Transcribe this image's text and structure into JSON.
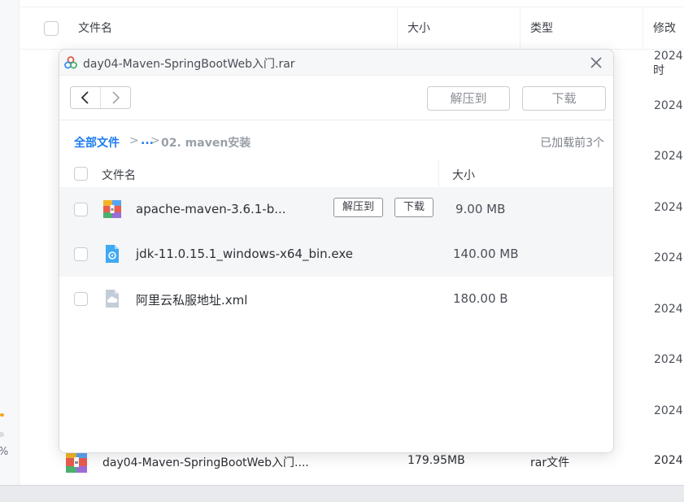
{
  "background": {
    "percent_text": "%",
    "columns": {
      "name": "文件名",
      "size": "大小",
      "type": "类型",
      "modified": "修改时"
    },
    "dates": [
      "2024.",
      "2024.",
      "2024.",
      "2024.",
      "2024.",
      "2024.",
      "2024.",
      "2024.",
      "2024."
    ],
    "bottom_row": {
      "name": "day04-Maven-SpringBootWeb入门....",
      "size": "179.95MB",
      "type": "rar文件",
      "modified": "2024."
    }
  },
  "dialog": {
    "title": "day04-Maven-SpringBootWeb入门.rar",
    "extract_label": "解压到",
    "download_label": "下载",
    "breadcrumb": {
      "root": "全部文件",
      "sep": ">",
      "ellipsis": "...",
      "current": "02. maven安装"
    },
    "status": "已加载前3个",
    "columns": {
      "name": "文件名",
      "size": "大小"
    },
    "files": [
      {
        "name": "apache-maven-3.6.1-b...",
        "size": "9.00 MB",
        "icon": "archive-icon",
        "extract_label": "解压到",
        "download_label": "下载"
      },
      {
        "name": "jdk-11.0.15.1_windows-x64_bin.exe",
        "size": "140.00 MB",
        "icon": "executable-icon"
      },
      {
        "name": "阿里云私服地址.xml",
        "size": "180.00 B",
        "icon": "document-icon"
      }
    ]
  },
  "colors": {
    "accent": "#1b7cf0",
    "muted": "#9aa0a8"
  }
}
